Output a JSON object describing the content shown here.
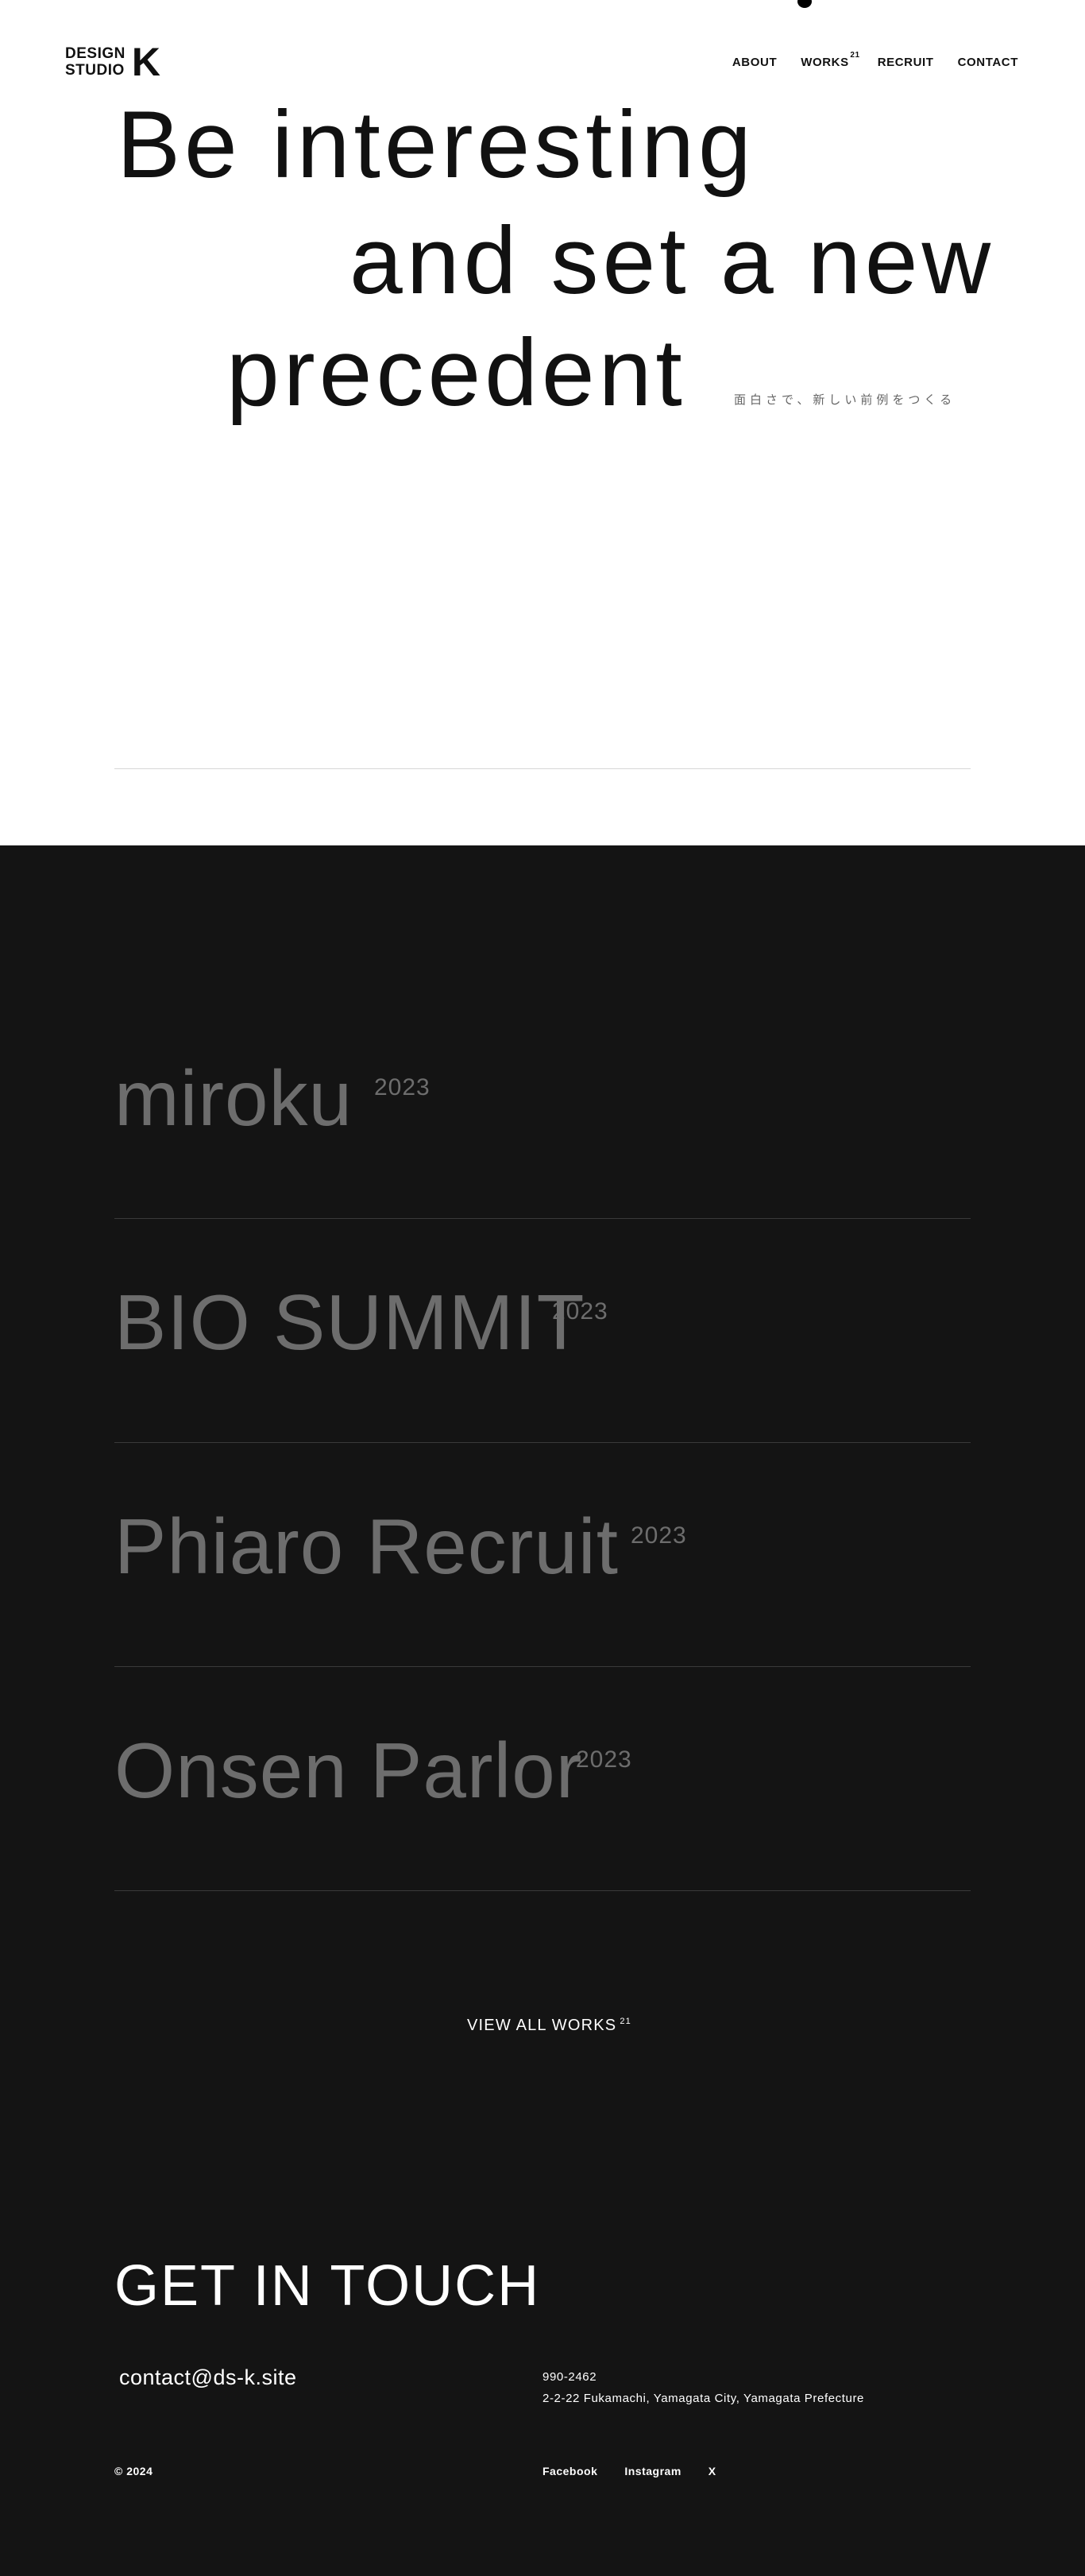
{
  "brand": {
    "line1": "DESIGN",
    "line2": "STUDIO",
    "mark": "K"
  },
  "nav": {
    "about": "ABOUT",
    "works": "WORKS",
    "works_count": "21",
    "recruit": "RECRUIT",
    "contact": "CONTACT"
  },
  "hero": {
    "line1": "Be interesting",
    "line2": "and set a new",
    "line3": "precedent",
    "subcopy": "面白さで、新しい前例をつくる"
  },
  "works": [
    {
      "title": "miroku",
      "year": "2023"
    },
    {
      "title": "BIO SUMMIT",
      "year": "2023"
    },
    {
      "title": "Phiaro Recruit",
      "year": "2023"
    },
    {
      "title": "Onsen Parlor",
      "year": "2023"
    }
  ],
  "view_all": {
    "label": "VIEW ALL WORKS",
    "count": "21"
  },
  "contact": {
    "heading": "GET IN TOUCH",
    "email": "contact@ds-k.site",
    "postal_code": "990-2462",
    "address": "2-2-22 Fukamachi, Yamagata City, Yamagata Prefecture"
  },
  "footer": {
    "copyright": "© 2024",
    "social": [
      "Facebook",
      "Instagram",
      "X"
    ]
  },
  "colors": {
    "hero_bg": "#ffffff",
    "dark_bg": "#141414",
    "text_dark": "#111111",
    "text_muted": "#6d6d6d",
    "text_light": "#ffffff"
  }
}
